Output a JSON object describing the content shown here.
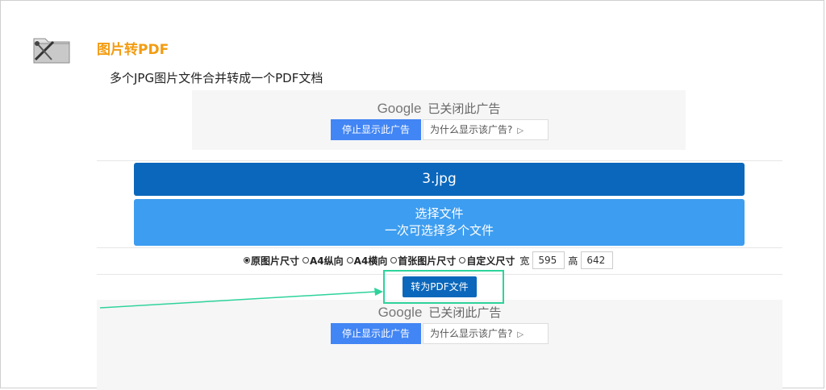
{
  "header": {
    "icon": "tools-icon",
    "title": "图片转PDF",
    "subtitle": "多个JPG图片文件合并转成一个PDF文档"
  },
  "ad_top": {
    "brand": "Google",
    "closed_text": "已关闭此广告",
    "stop_label": "停止显示此广告",
    "why_label": "为什么显示该广告?"
  },
  "file": {
    "selected_name": "3.jpg",
    "choose_line1": "选择文件",
    "choose_line2": "一次可选择多个文件"
  },
  "size_options": {
    "items": [
      "原图片尺寸",
      "A4纵向",
      "A4横向",
      "首张图片尺寸",
      "自定义尺寸"
    ],
    "selected": "原图片尺寸",
    "width_label": "宽",
    "width_value": "595",
    "height_label": "高",
    "height_value": "642"
  },
  "convert": {
    "label": "转为PDF文件",
    "highlight_color": "#2ed39b"
  },
  "ad_bottom": {
    "brand": "Google",
    "closed_text": "已关闭此广告",
    "stop_label": "停止显示此广告",
    "why_label": "为什么显示该广告?"
  },
  "colors": {
    "title": "#f39c12",
    "file_bar": "#0b67bb",
    "choose_button": "#3d9df0",
    "ad_button": "#4285f4"
  }
}
